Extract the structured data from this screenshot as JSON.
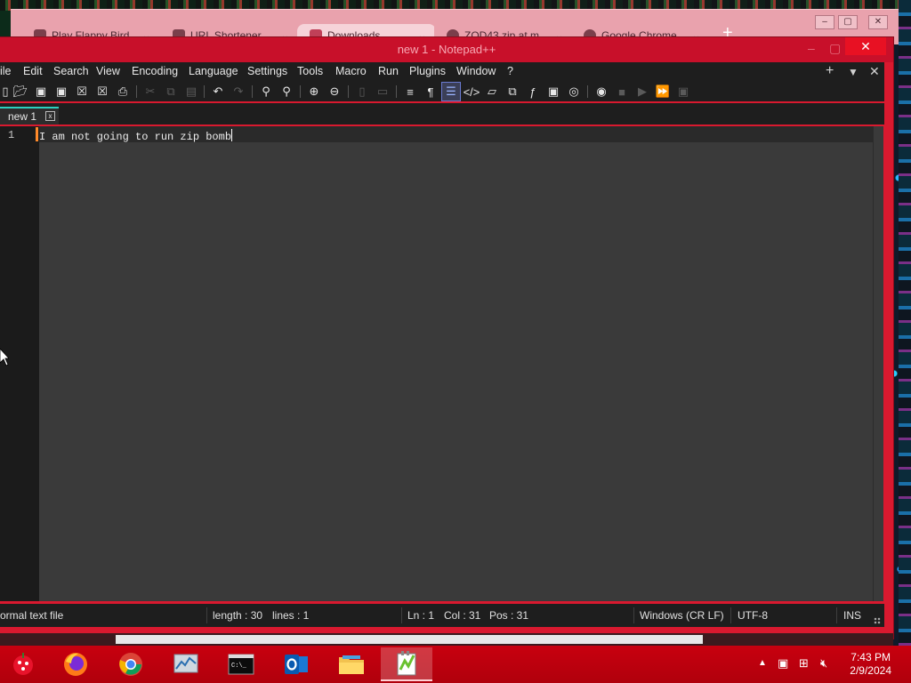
{
  "browser": {
    "tabs": [
      {
        "label": "Play Flappy Bird"
      },
      {
        "label": "URL Shortener"
      },
      {
        "label": "Downloads"
      },
      {
        "label": "ZOD43.zip at m"
      },
      {
        "label": "Google Chrome"
      }
    ],
    "new_tab": "+",
    "minimize": "–",
    "maximize": "▢",
    "close": "✕"
  },
  "notepad": {
    "title": "new 1 - Notepad++",
    "close": "✕",
    "menu": [
      "ile",
      "Edit",
      "Search",
      "View",
      "Encoding",
      "Language",
      "Settings",
      "Tools",
      "Macro",
      "Run",
      "Plugins",
      "Window",
      "?"
    ],
    "menu_right": {
      "add": "+",
      "dropdown": "▼",
      "close": "✕"
    },
    "doc_tab": {
      "label": "new 1",
      "close": "x"
    },
    "editor": {
      "line_number": "1",
      "line_text": "I am not going to run zip bomb"
    },
    "status": {
      "file_type": "ormal text file",
      "length": "length : 30",
      "lines": "lines : 1",
      "ln": "Ln : 1",
      "col": "Col : 31",
      "pos": "Pos : 31",
      "eol": "Windows (CR LF)",
      "encoding": "UTF-8",
      "mode": "INS"
    }
  },
  "taskbar": {
    "apps": [
      "antivirus",
      "firefox",
      "chrome",
      "task-manager",
      "command-prompt",
      "outlook",
      "file-explorer",
      "notepad-plus-plus"
    ],
    "active_app": "notepad-plus-plus",
    "tray_arrow": "▲",
    "time": "7:43 PM",
    "date": "2/9/2024"
  },
  "colors": {
    "window_frame": "#d9192f",
    "taskbar": "#c8000f",
    "editor_bg": "#3a3a3a",
    "active_tab_accent": "#2bd0c0"
  }
}
